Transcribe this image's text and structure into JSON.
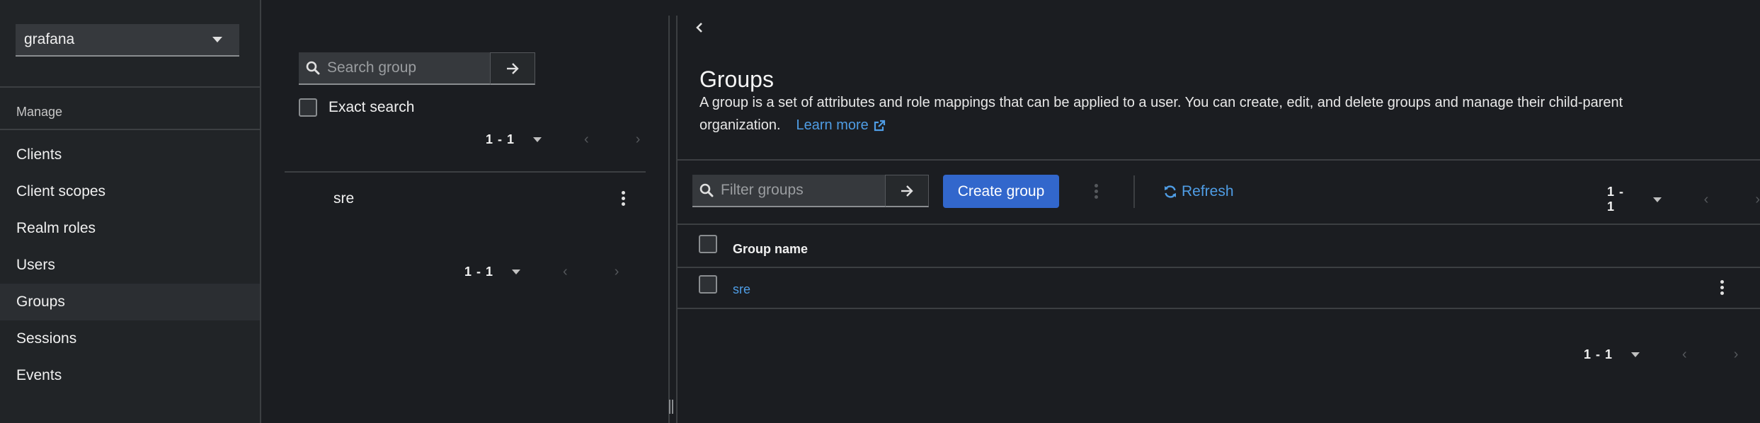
{
  "sidebar": {
    "realm_selector": "grafana",
    "section_label": "Manage",
    "items": [
      {
        "label": "Clients"
      },
      {
        "label": "Client scopes"
      },
      {
        "label": "Realm roles"
      },
      {
        "label": "Users"
      },
      {
        "label": "Groups"
      },
      {
        "label": "Sessions"
      },
      {
        "label": "Events"
      }
    ]
  },
  "tree_panel": {
    "search_placeholder": "Search group",
    "exact_search_label": "Exact search",
    "pager_top": "1 - 1",
    "items": [
      {
        "label": "sre"
      }
    ],
    "pager_bottom": "1 - 1"
  },
  "main": {
    "title": "Groups",
    "description_line1": "A group is a set of attributes and role mappings that can be applied to a user. You can create, edit, and delete groups and manage their child-parent",
    "description_line2": "organization.",
    "learn_more": "Learn more",
    "filter_placeholder": "Filter groups",
    "create_button": "Create group",
    "refresh_button": "Refresh",
    "pager_top": "1 - 1",
    "table": {
      "columns": [
        "Group name"
      ],
      "rows": [
        {
          "name": "sre"
        }
      ]
    },
    "pager_bottom": "1 - 1"
  },
  "colors": {
    "background": "#1b1d21",
    "sidebar": "#212427",
    "primary_button": "#3267cc",
    "link": "#4f9de5"
  }
}
